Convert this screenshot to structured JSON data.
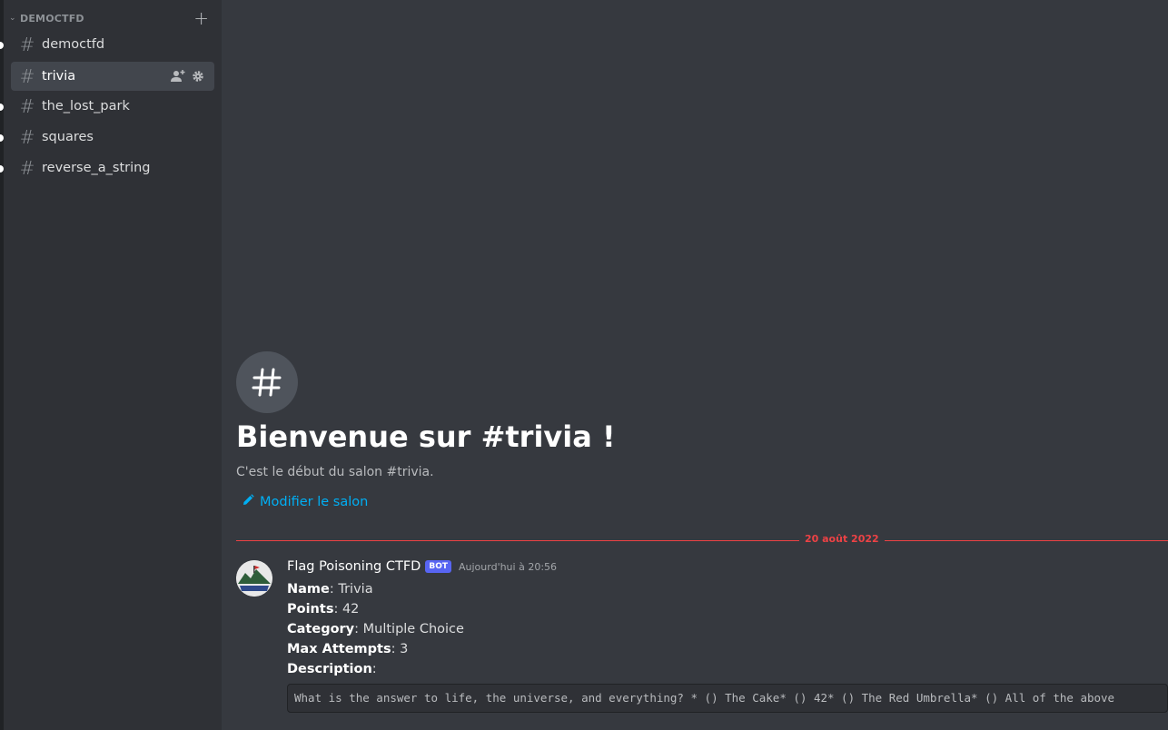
{
  "sidebar": {
    "category": "DEMOCTFD",
    "channels": [
      {
        "name": "democtfd"
      },
      {
        "name": "trivia"
      },
      {
        "name": "the_lost_park"
      },
      {
        "name": "squares"
      },
      {
        "name": "reverse_a_string"
      }
    ]
  },
  "welcome": {
    "title": "Bienvenue sur #trivia !",
    "subtitle": "C'est le début du salon #trivia.",
    "edit_label": "Modifier le salon"
  },
  "divider": {
    "date": "20 août 2022"
  },
  "message": {
    "author": "Flag Poisoning CTFD",
    "bot_tag": "BOT",
    "timestamp": "Aujourd'hui à 20:56",
    "fields": [
      {
        "label": "Name",
        "value": ": Trivia"
      },
      {
        "label": "Points",
        "value": ": 42"
      },
      {
        "label": "Category",
        "value": ": Multiple Choice"
      },
      {
        "label": "Max Attempts",
        "value": ": 3"
      },
      {
        "label": "Description",
        "value": ":"
      }
    ],
    "code": "What is the answer to life, the universe, and everything? * () The Cake* () 42* () The Red Umbrella* () All of the above"
  },
  "colors": {
    "accent_link": "#00aff4",
    "divider_red": "#ed4245",
    "bot_tag": "#5865f2"
  }
}
